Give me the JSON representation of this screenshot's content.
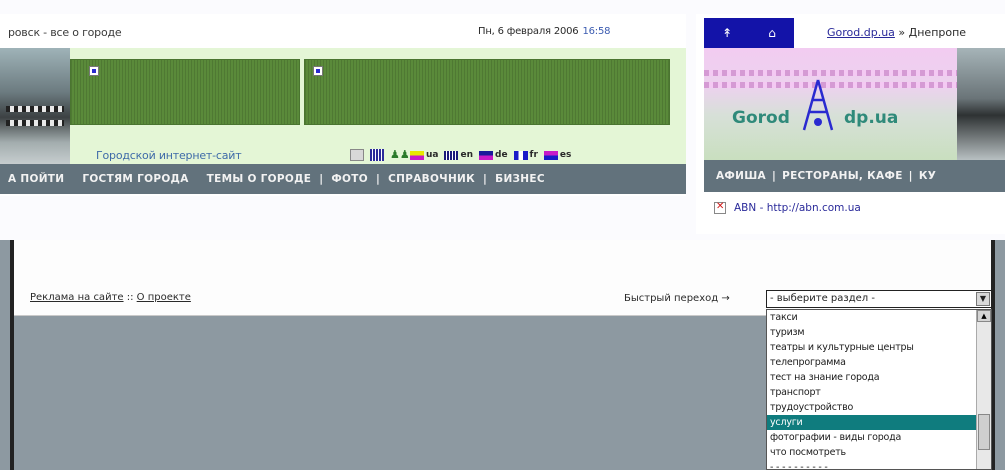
{
  "left_window": {
    "title": "ровск - все о городе",
    "date": "Пн, 6 февраля 2006",
    "time": "16:58",
    "tagline": "Городской интернет-сайт",
    "languages": [
      {
        "label": "ua",
        "color": "#e8e800"
      },
      {
        "label": "en",
        "color": "#1a1a7a"
      },
      {
        "label": "de",
        "color": "#1a1a9a"
      },
      {
        "label": "fr",
        "color": "#1a1ac8"
      },
      {
        "label": "es",
        "color": "#c81ac8"
      }
    ],
    "nav": [
      "А ПОЙТИ",
      "ГОСТЯМ ГОРОДА",
      "ТЕМЫ О ГОРОДЕ",
      "ФОТО",
      "СПРАВОЧНИК",
      "БИЗНЕС"
    ]
  },
  "right_window": {
    "toolbar_icons": [
      "arrow-up-icon",
      "home-icon"
    ],
    "breadcrumb_link": "Gorod.dp.ua",
    "breadcrumb_rest": " » Днепропе",
    "logo_left": "Gorod",
    "logo_right": "dp.ua",
    "nav": [
      "АФИША",
      "РЕСТОРАНЫ, КАФЕ",
      "КУ"
    ],
    "abn_link": "ABN - http://abn.com.ua"
  },
  "footer": {
    "link_ads": "Реклама на сайте",
    "link_separator": " :: ",
    "link_about": "О проекте",
    "quick_label": "Быстрый переход →",
    "select_value": "- выберите раздел -",
    "dropdown_options": [
      "такси",
      "туризм",
      "театры и культурные центры",
      "телепрограмма",
      "тест на знание города",
      "транспорт",
      "трудоустройство",
      "услуги",
      "фотографии - виды города",
      "что посмотреть",
      "- - - - - - - - - -"
    ],
    "selected_option_index": 7
  },
  "colors": {
    "nav_bg": "#62727c",
    "green_banner": "#5a8a3a",
    "toolbar_blue": "#1313a8",
    "selection_teal": "#0f7c7e",
    "page_gray": "#8d99a1"
  }
}
